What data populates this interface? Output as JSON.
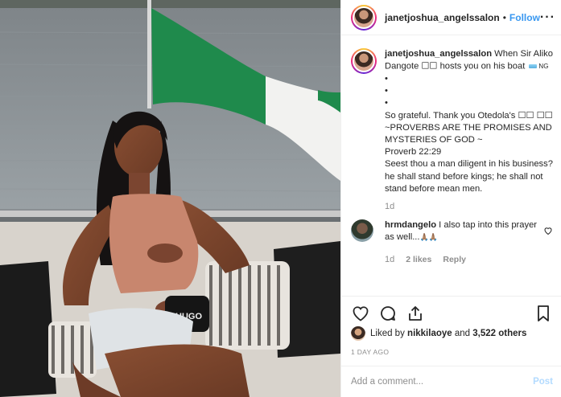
{
  "post": {
    "author": "janetjoshua_angelssalon",
    "follow_label": "Follow",
    "header_separator": "•",
    "more_label": "···"
  },
  "caption": {
    "username": "janetjoshua_angelssalon",
    "line1": "When Sir Aliko Dangote ☐☐ hosts you on his boat",
    "flag_text": "NG",
    "bullets": [
      "•",
      "•",
      "•"
    ],
    "text2": "So grateful. Thank you Otedola's ☐☐ ☐☐ ~PROVERBS ARE THE PROMISES AND MYSTERIES OF GOD ~",
    "text3": "Proverb 22:29",
    "text4": "Seest thou a man diligent in his business? he shall stand before kings; he shall not stand before mean men.",
    "time": "1d"
  },
  "reply": {
    "username": "hrmdangelo",
    "text": "I also tap into this prayer as well...",
    "emoji": "🙏🏽🙏🏽",
    "time": "1d",
    "likes": "2 likes",
    "reply_label": "Reply"
  },
  "likes": {
    "prefix": "Liked by",
    "user": "nikkilaoye",
    "conj": "and",
    "count": "3,522 others"
  },
  "time_ago": "1 DAY AGO",
  "comment_box": {
    "placeholder": "Add a comment...",
    "post_label": "Post"
  },
  "photo": {
    "bag_text": "HUGO"
  }
}
